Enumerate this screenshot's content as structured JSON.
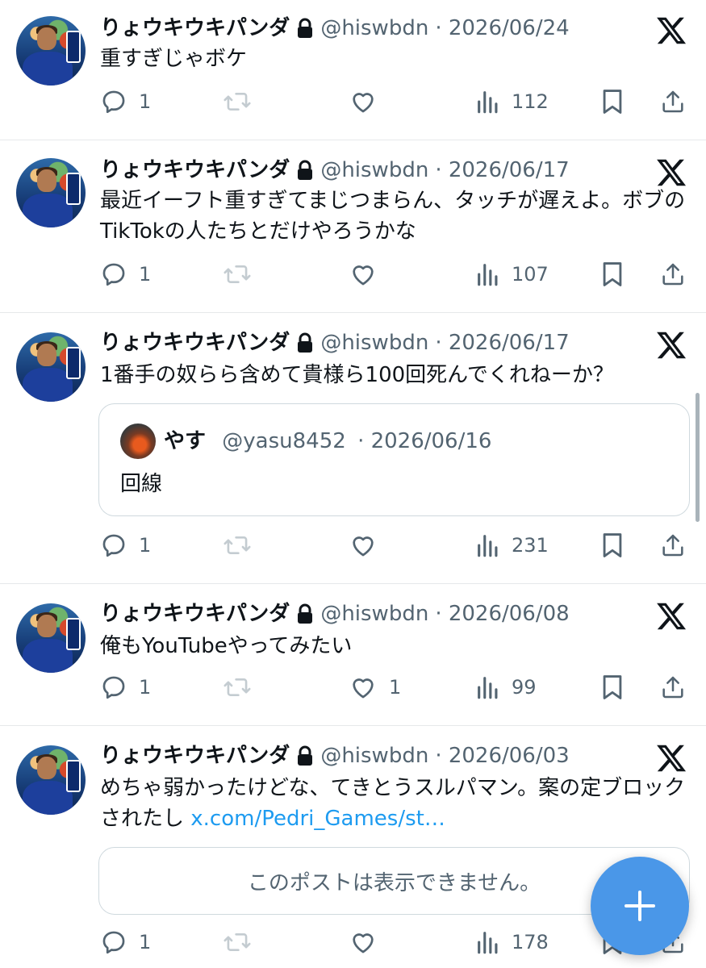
{
  "author": {
    "name": "りょウキウキパンダ",
    "handle": "@hiswbdn",
    "protected": true
  },
  "tweets": [
    {
      "date": "· 2026/06/24",
      "text": "重すぎじゃボケ",
      "replies": "1",
      "retweets": "",
      "likes": "",
      "views": "112"
    },
    {
      "date": "· 2026/06/17",
      "text": "最近イーフト重すぎてまじつまらん、タッチが遅えよ。ボブのTikTokの人たちとだけやろうかな",
      "replies": "1",
      "retweets": "",
      "likes": "",
      "views": "107"
    },
    {
      "date": "· 2026/06/17",
      "text": "1番手の奴らら含めて貴様ら100回死んでくれねーか？",
      "quote": {
        "name": "やす",
        "handle": "@yasu8452",
        "date": "· 2026/06/16",
        "text": "回線"
      },
      "replies": "1",
      "retweets": "",
      "likes": "",
      "views": "231"
    },
    {
      "date": "· 2026/06/08",
      "text": "俺もYouTubeやってみたい",
      "replies": "1",
      "retweets": "",
      "likes": "1",
      "views": "99"
    },
    {
      "date": "· 2026/06/03",
      "text": "めちゃ弱かったけどな、てきとうスルパマン。案の定ブロックされたし ",
      "link": "x.com/Pedri_Games/st…",
      "unavailable_text": "このポストは表示できません。",
      "replies": "1",
      "retweets": "",
      "likes": "",
      "views": "178"
    }
  ],
  "icons": {
    "reply": "reply-icon",
    "retweet": "retweet-icon",
    "like": "heart-icon",
    "views": "views-icon",
    "bookmark": "bookmark-icon",
    "share": "share-icon",
    "x_logo": "x-logo-icon",
    "lock": "lock-icon",
    "compose": "plus-icon"
  },
  "colors": {
    "text": "#0f1419",
    "secondary": "#536471",
    "link": "#1d9bf0",
    "fab": "#4a97e8"
  }
}
